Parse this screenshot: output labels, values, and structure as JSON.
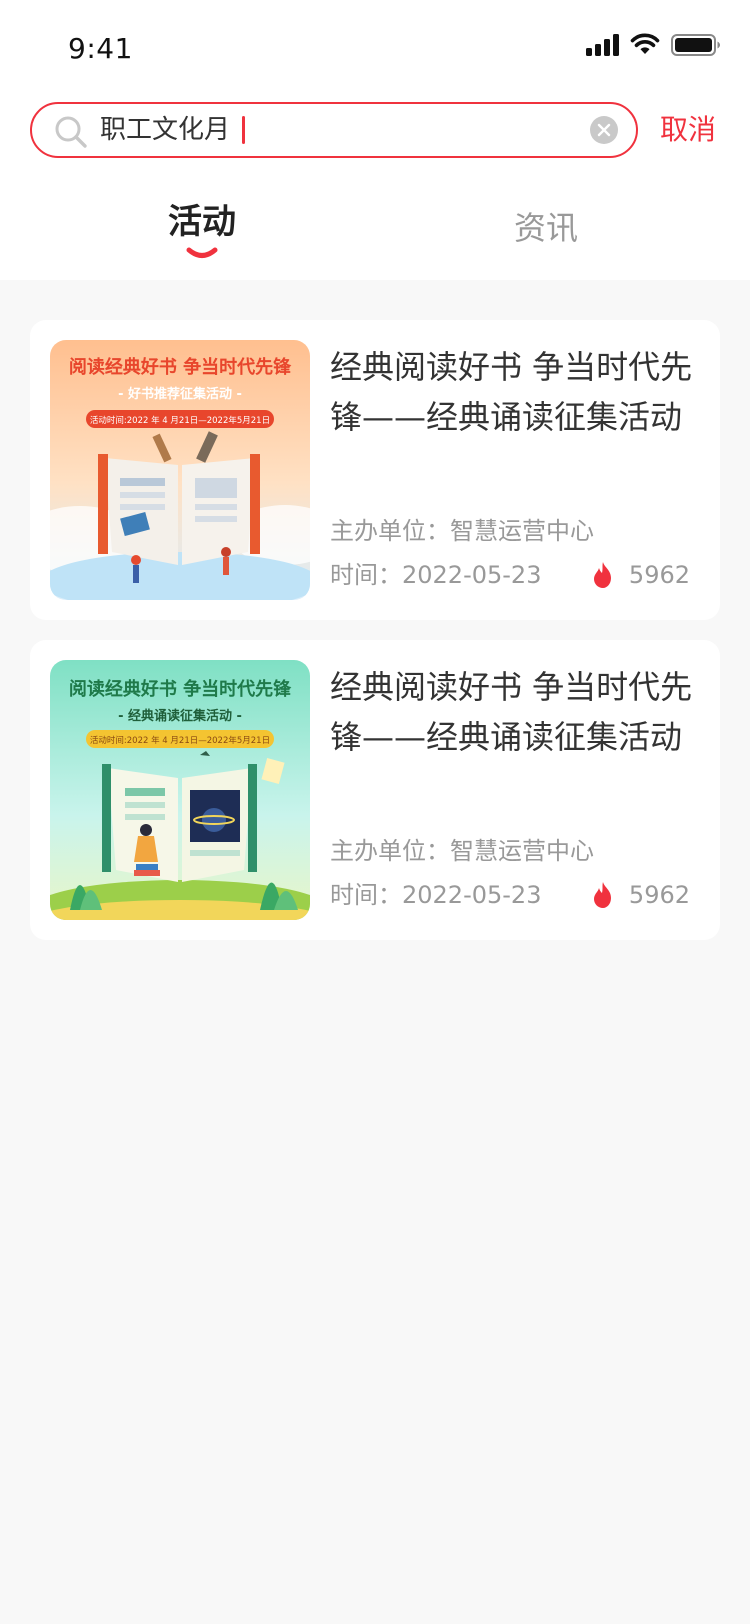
{
  "status_bar": {
    "time": "9:41"
  },
  "search": {
    "query": "职工文化月",
    "cancel_label": "取消"
  },
  "tabs": [
    {
      "label": "活动",
      "active": true
    },
    {
      "label": "资讯",
      "active": false
    }
  ],
  "colors": {
    "accent": "#f0323e",
    "background": "#f8f8f8"
  },
  "activities": [
    {
      "title": "经典阅读好书 争当时代先锋——经典诵读征集活动",
      "organizer": "主办单位：智慧运营中心",
      "time": "时间：2022-05-23",
      "heat": "5962",
      "cover": {
        "headline": "阅读经典好书 争当时代先锋",
        "subhead": "- 好书推荐征集活动 -",
        "dates": "活动时间:2022 年 4 月21日—2022年5月21日",
        "theme": "orange"
      }
    },
    {
      "title": "经典阅读好书 争当时代先锋——经典诵读征集活动",
      "organizer": "主办单位：智慧运营中心",
      "time": "时间：2022-05-23",
      "heat": "5962",
      "cover": {
        "headline": "阅读经典好书 争当时代先锋",
        "subhead": "- 经典诵读征集活动 -",
        "dates": "活动时间:2022 年 4 月21日—2022年5月21日",
        "theme": "green"
      }
    }
  ]
}
